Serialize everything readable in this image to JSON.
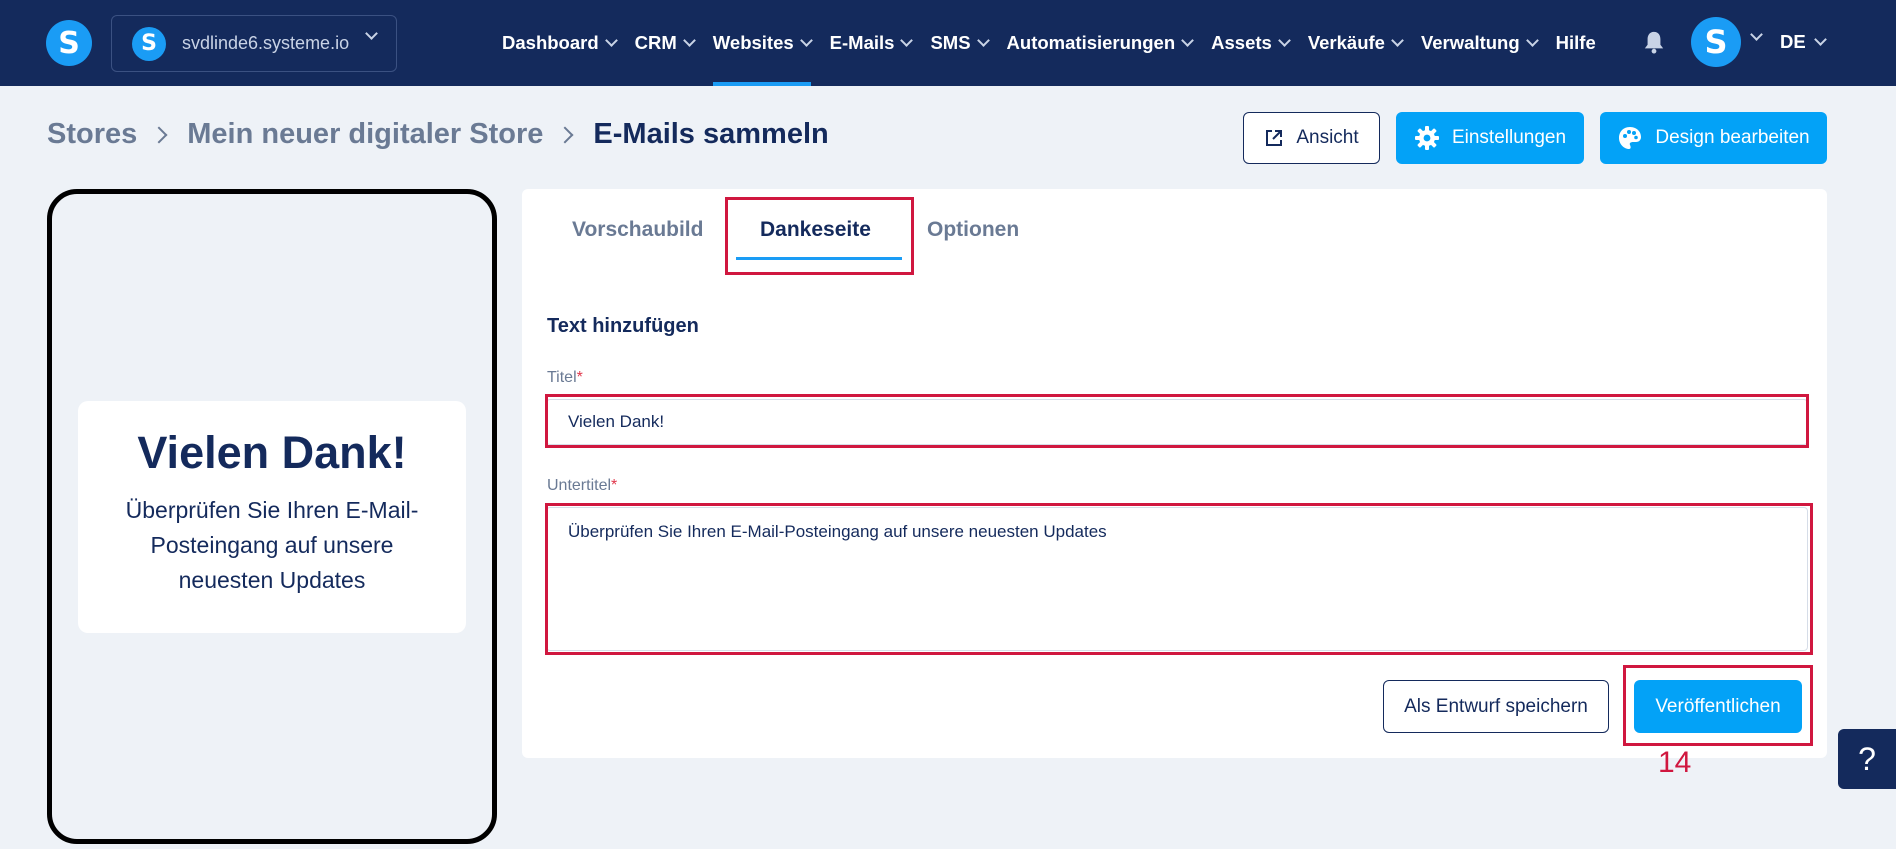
{
  "topbar": {
    "logo_letter": "S",
    "site_selector": {
      "badge_letter": "S",
      "site_name": "svdlinde6.systeme.io"
    },
    "nav": [
      {
        "label": "Dashboard"
      },
      {
        "label": "CRM"
      },
      {
        "label": "Websites"
      },
      {
        "label": "E-Mails"
      },
      {
        "label": "SMS"
      },
      {
        "label": "Automatisierungen"
      },
      {
        "label": "Assets"
      },
      {
        "label": "Verkäufe"
      },
      {
        "label": "Verwaltung"
      }
    ],
    "active_nav": "Websites",
    "help_label": "Hilfe",
    "avatar_letter": "S",
    "language": "DE"
  },
  "breadcrumb": {
    "items": [
      "Stores",
      "Mein neuer digitaler Store",
      "E-Mails sammeln"
    ]
  },
  "actions": {
    "view_label": "Ansicht",
    "settings_label": "Einstellungen",
    "design_label": "Design bearbeiten"
  },
  "preview": {
    "title": "Vielen Dank!",
    "subtitle": "Überprüfen Sie Ihren E-Mail-Posteingang auf unsere neuesten Updates"
  },
  "tabs": {
    "items": [
      "Vorschaubild",
      "Dankeseite",
      "Optionen"
    ],
    "active": "Dankeseite"
  },
  "form": {
    "section_title": "Text hinzufügen",
    "title_label": "Titel",
    "title_value": "Vielen Dank!",
    "subtitle_label": "Untertitel",
    "subtitle_value": "Überprüfen Sie Ihren E-Mail-Posteingang auf unsere neuesten Updates",
    "required_mark": "*",
    "draft_label": "Als Entwurf speichern",
    "publish_label": "Veröffentlichen"
  },
  "annotation": {
    "step_number": "14",
    "color": "#d0173f"
  },
  "help_button": "?",
  "colors": {
    "navy": "#142a5c",
    "accent": "#03a2f7",
    "background": "#eef2f7"
  }
}
